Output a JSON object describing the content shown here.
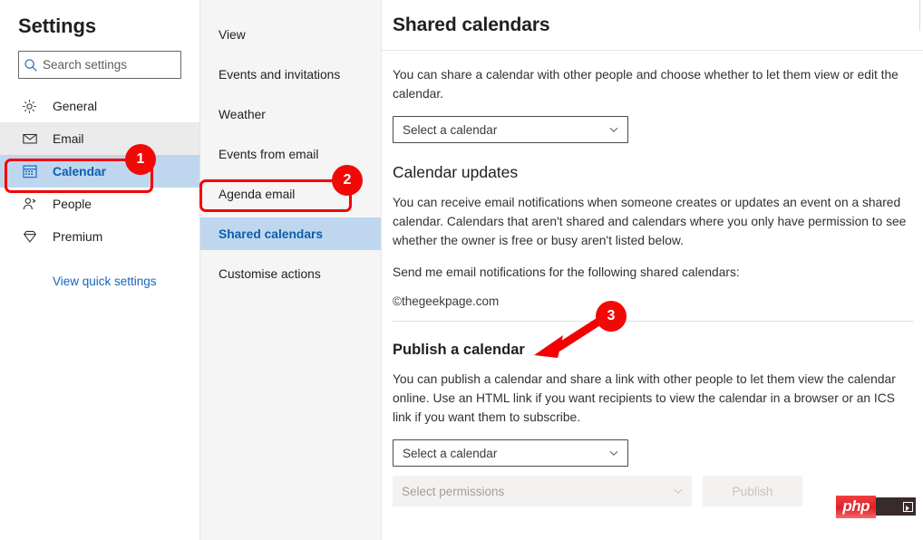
{
  "sidebar": {
    "title": "Settings",
    "search": {
      "placeholder": "Search settings",
      "icon": "search-icon",
      "value": ""
    },
    "items": [
      {
        "label": "General",
        "icon": "gear-icon",
        "state": "normal"
      },
      {
        "label": "Email",
        "icon": "envelope-icon",
        "state": "hovered"
      },
      {
        "label": "Calendar",
        "icon": "calendar-icon",
        "state": "selected"
      },
      {
        "label": "People",
        "icon": "person-icon",
        "state": "normal"
      },
      {
        "label": "Premium",
        "icon": "diamond-icon",
        "state": "normal"
      }
    ],
    "quick_settings_link": "View quick settings"
  },
  "midcol": {
    "items": [
      {
        "label": "View",
        "state": "normal"
      },
      {
        "label": "Events and invitations",
        "state": "normal"
      },
      {
        "label": "Weather",
        "state": "normal"
      },
      {
        "label": "Events from email",
        "state": "normal"
      },
      {
        "label": "Agenda email",
        "state": "normal"
      },
      {
        "label": "Shared calendars",
        "state": "selected"
      },
      {
        "label": "Customise actions",
        "state": "normal"
      }
    ]
  },
  "main": {
    "title": "Shared calendars",
    "intro_paragraph": "You can share a calendar with other people and choose whether to let them view or edit the calendar.",
    "share_select": {
      "value": "Select a calendar",
      "chevron": "chevron-down-icon"
    },
    "calendar_updates": {
      "heading": "Calendar updates",
      "paragraph": "You can receive email notifications when someone creates or updates an event on a shared calendar. Calendars that aren't shared and calendars where you only have permission to see whether the owner is free or busy aren't listed below.",
      "subtext": "Send me email notifications for the following shared calendars:",
      "watermark": "©thegeekpage.com"
    },
    "publish": {
      "heading": "Publish a calendar",
      "paragraph": "You can publish a calendar and share a link with other people to let them view the calendar online. Use an HTML link if you want recipients to view the calendar in a browser or an ICS link if you want them to subscribe.",
      "calendar_select": {
        "value": "Select a calendar",
        "chevron": "chevron-down-icon"
      },
      "permissions_select": {
        "value": "Select permissions",
        "chevron": "chevron-down-icon",
        "disabled": true
      },
      "publish_button": {
        "label": "Publish",
        "disabled": true
      }
    }
  },
  "watermark_badge": {
    "text": "php"
  },
  "annotations": {
    "colors": {
      "highlight": "#f50000",
      "badge": "#f30808",
      "badge_text": "#ffffff",
      "selected_bg": "#bed7ef",
      "selected_text": "#0f5dab",
      "link": "#1a63b8"
    },
    "steps": [
      {
        "number": "1",
        "target": "sidebar-item-calendar"
      },
      {
        "number": "2",
        "target": "midcol-item-shared-calendars"
      },
      {
        "number": "3",
        "target": "publish-a-calendar-heading"
      }
    ]
  }
}
